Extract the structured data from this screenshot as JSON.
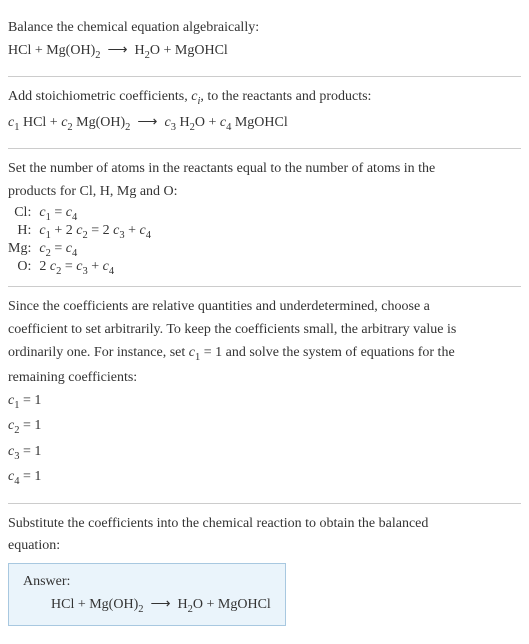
{
  "section1": {
    "line1": "Balance the chemical equation algebraically:",
    "eq": "HCl + Mg(OH)₂  ⟶  H₂O + MgOHCl"
  },
  "section2": {
    "line1_a": "Add stoichiometric coefficients, ",
    "line1_b": "c",
    "line1_c": ", to the reactants and products:",
    "eq_a": "c₁ HCl + c₂ Mg(OH)₂  ⟶  c₃ H₂O + c₄ MgOHCl"
  },
  "section3": {
    "line1": "Set the number of atoms in the reactants equal to the number of atoms in the",
    "line2": "products for Cl, H, Mg and O:",
    "rows": {
      "cl_label": "Cl:",
      "cl_eq": "c₁ = c₄",
      "h_label": "H:",
      "h_eq": "c₁ + 2 c₂ = 2 c₃ + c₄",
      "mg_label": "Mg:",
      "mg_eq": "c₂ = c₄",
      "o_label": "O:",
      "o_eq": "2 c₂ = c₃ + c₄"
    }
  },
  "section4": {
    "line1": "Since the coefficients are relative quantities and underdetermined, choose a",
    "line2": "coefficient to set arbitrarily. To keep the coefficients small, the arbitrary value is",
    "line3": "ordinarily one. For instance, set c₁ = 1 and solve the system of equations for the",
    "line4": "remaining coefficients:",
    "c1": "c₁ = 1",
    "c2": "c₂ = 1",
    "c3": "c₃ = 1",
    "c4": "c₄ = 1"
  },
  "section5": {
    "line1": "Substitute the coefficients into the chemical reaction to obtain the balanced",
    "line2": "equation:",
    "answer_label": "Answer:",
    "answer_eq": "HCl + Mg(OH)₂  ⟶  H₂O + MgOHCl"
  }
}
